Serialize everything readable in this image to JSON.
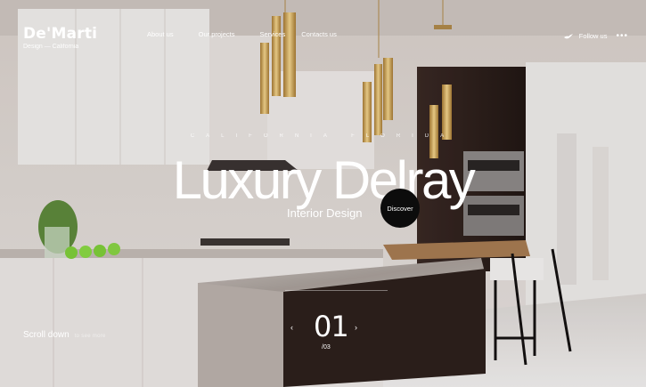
{
  "brand": {
    "name": "De'Marti",
    "tagline": "Design — California"
  },
  "nav": {
    "items": [
      {
        "label": "About us"
      },
      {
        "label": "Our projects"
      },
      {
        "label": "Services"
      },
      {
        "label": "Contacts us"
      }
    ]
  },
  "follow": {
    "label": "Follow us",
    "icon": "bird-icon",
    "menu_icon": "more-dots-icon"
  },
  "hero": {
    "eyebrow": "CALIFORNIA FLORIDA",
    "title": "Luxury Delray",
    "subtitle": "Interior Design",
    "cta": "Discover"
  },
  "scroll": {
    "label": "Scroll down",
    "note": "to see more"
  },
  "slider": {
    "current": "01",
    "total": "/03",
    "prev_icon": "chevron-left-icon",
    "next_icon": "chevron-right-icon"
  },
  "colors": {
    "text": "#ffffff",
    "cta_bg": "#0c0c0c",
    "wall": "#e3dbd6",
    "cabinet_dark": "#2b1e1a",
    "marble": "#b5aca7"
  }
}
